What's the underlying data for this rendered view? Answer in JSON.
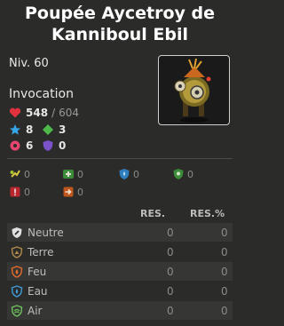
{
  "title_line1": "Poupée Aycetroy de",
  "title_line2": "Kanniboul Ebil",
  "level": "Niv. 60",
  "type": "Invocation",
  "stats": {
    "hp": "548",
    "hp_sep": "/",
    "hp_max": "604",
    "ap": "8",
    "mp": "3",
    "range": "6",
    "shield": "0"
  },
  "mini_stats": [
    "0",
    "0",
    "0",
    "0",
    "0",
    "0"
  ],
  "res_headers": {
    "res": "RES.",
    "res_pct": "RES.%"
  },
  "resistances": [
    {
      "name": "Neutre",
      "res": "0",
      "pct": "0"
    },
    {
      "name": "Terre",
      "res": "0",
      "pct": "0"
    },
    {
      "name": "Feu",
      "res": "0",
      "pct": "0"
    },
    {
      "name": "Eau",
      "res": "0",
      "pct": "0"
    },
    {
      "name": "Air",
      "res": "0",
      "pct": "0"
    }
  ],
  "colors": {
    "background": "#2b2b2a",
    "hp": "#e0323c",
    "ap": "#35a6e8",
    "mp": "#4fb84a",
    "range": "#e8456e",
    "shield": "#7b52c9"
  }
}
